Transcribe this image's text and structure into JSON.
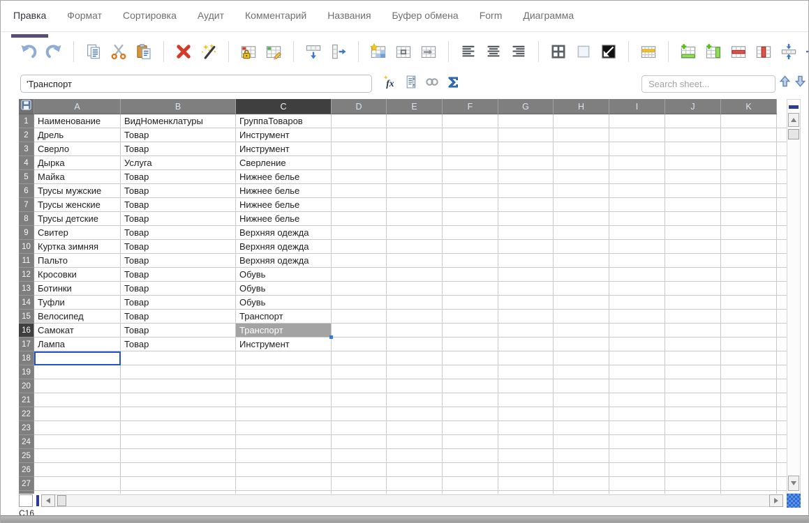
{
  "menu": {
    "tabs": [
      {
        "label": "Правка",
        "active": true
      },
      {
        "label": "Формат",
        "active": false
      },
      {
        "label": "Сортировка",
        "active": false
      },
      {
        "label": "Аудит",
        "active": false
      },
      {
        "label": "Комментарий",
        "active": false
      },
      {
        "label": "Названия",
        "active": false
      },
      {
        "label": "Буфер обмена",
        "active": false
      },
      {
        "label": "Form",
        "active": false
      },
      {
        "label": "Диаграмма",
        "active": false
      }
    ]
  },
  "toolbar": {
    "groups": [
      [
        "undo",
        "redo"
      ],
      [
        "copy",
        "cut",
        "paste"
      ],
      [
        "delete",
        "magic-wand"
      ],
      [
        "protect-cells",
        "edit-cells"
      ],
      [
        "insert-row",
        "insert-column"
      ],
      [
        "format-table",
        "merge-cells",
        "goto-cell"
      ],
      [
        "align-left",
        "align-center",
        "align-right"
      ],
      [
        "borders",
        "fill-color",
        "invert-colors"
      ],
      [
        "highlight-row"
      ],
      [
        "add-row",
        "add-column",
        "delete-row",
        "delete-column",
        "fit-row-height",
        "fit-column-width"
      ]
    ]
  },
  "formula_bar": {
    "value": "'Транспорт",
    "icons": [
      "insert-function",
      "name-manager",
      "hyperlink",
      "autosum"
    ],
    "search_placeholder": "Search sheet..."
  },
  "sheet": {
    "columns": [
      "A",
      "B",
      "C",
      "D",
      "E",
      "F",
      "G",
      "H",
      "I",
      "J",
      "K"
    ],
    "row_count": 28,
    "rows": [
      [
        "Наименование",
        "ВидНоменклатуры",
        "ГруппаТоваров"
      ],
      [
        "Дрель",
        "Товар",
        "Инструмент"
      ],
      [
        "Сверло",
        "Товар",
        "Инструмент"
      ],
      [
        "Дырка",
        "Услуга",
        "Сверление"
      ],
      [
        "Майка",
        "Товар",
        "Нижнее белье"
      ],
      [
        "Трусы мужские",
        "Товар",
        "Нижнее белье"
      ],
      [
        "Трусы женские",
        "Товар",
        "Нижнее белье"
      ],
      [
        "Трусы детские",
        "Товар",
        "Нижнее белье"
      ],
      [
        "Свитер",
        "Товар",
        "Верхняя одежда"
      ],
      [
        "Куртка зимняя",
        "Товар",
        "Верхняя одежда"
      ],
      [
        "Пальто",
        "Товар",
        "Верхняя одежда"
      ],
      [
        "Кросовки",
        "Товар",
        "Обувь"
      ],
      [
        "Ботинки",
        "Товар",
        "Обувь"
      ],
      [
        "Туфли",
        "Товар",
        "Обувь"
      ],
      [
        "Велосипед",
        "Товар",
        "Транспорт"
      ],
      [
        "Самокат",
        "Товар",
        "Транспорт"
      ],
      [
        "Лампа",
        "Товар",
        "Инструмент"
      ]
    ],
    "selection": {
      "active_cell": "C16",
      "active_value": "Транспорт",
      "selected_column": "C",
      "selected_row": 16,
      "cursor_cell": "A18"
    }
  },
  "status_bar": {
    "cell_ref": "C16"
  },
  "colors": {
    "accent_purple": "#5a4b78",
    "selection_gray": "#a3a3a3",
    "cursor_blue": "#2353c6",
    "header_gray": "#7f7f7f",
    "header_selected": "#3f3f3f",
    "corner_blue": "#2f6bd0"
  }
}
